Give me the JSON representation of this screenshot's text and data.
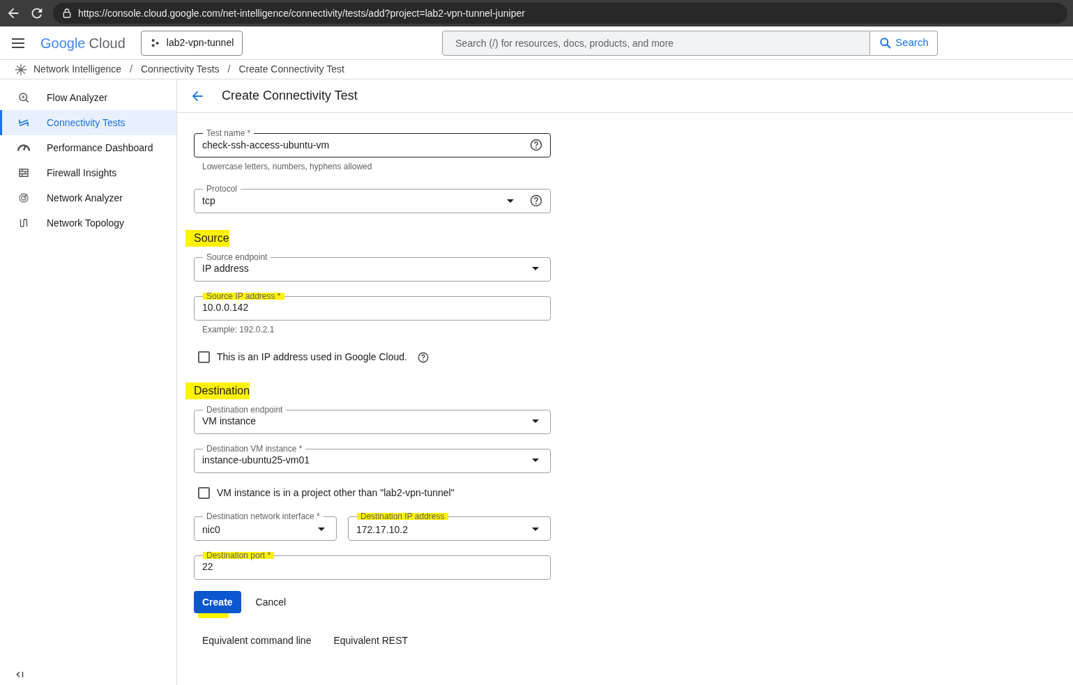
{
  "browser": {
    "url": "https://console.cloud.google.com/net-intelligence/connectivity/tests/add?project=lab2-vpn-tunnel-juniper"
  },
  "header": {
    "logo_google": "Google",
    "logo_cloud": "Cloud",
    "project": "lab2-vpn-tunnel",
    "search_placeholder": "Search (/) for resources, docs, products, and more",
    "search_button": "Search"
  },
  "breadcrumbs": [
    "Network Intelligence",
    "Connectivity Tests",
    "Create Connectivity Test"
  ],
  "breadcrumb_separator": "/",
  "sidebar": {
    "items": [
      {
        "label": "Flow Analyzer",
        "selected": false
      },
      {
        "label": "Connectivity Tests",
        "selected": true
      },
      {
        "label": "Performance Dashboard",
        "selected": false
      },
      {
        "label": "Firewall Insights",
        "selected": false
      },
      {
        "label": "Network Analyzer",
        "selected": false
      },
      {
        "label": "Network Topology",
        "selected": false
      }
    ]
  },
  "page": {
    "title": "Create Connectivity Test"
  },
  "form": [
    {
      "kind": "input",
      "label": "Test name *",
      "value": "check-ssh-access-ubuntu-vm",
      "help": true,
      "focused": true,
      "highlighted": false
    },
    {
      "kind": "hint",
      "text": "Lowercase letters, numbers, hyphens allowed"
    },
    {
      "kind": "select",
      "label": "Protocol",
      "value": "tcp",
      "help": true,
      "highlighted": false
    },
    {
      "kind": "section",
      "text": "Source",
      "highlighted": true
    },
    {
      "kind": "select",
      "label": "Source endpoint",
      "value": "IP address",
      "help": false,
      "highlighted": false
    },
    {
      "kind": "input",
      "label": "Source IP address *",
      "value": "10.0.0.142",
      "help": false,
      "focused": false,
      "highlighted": true
    },
    {
      "kind": "hint",
      "text": "Example: 192.0.2.1"
    },
    {
      "kind": "checkbox",
      "label": "This is an IP address used in Google Cloud.",
      "checked": false,
      "help": true
    },
    {
      "kind": "section",
      "text": "Destination",
      "highlighted": true
    },
    {
      "kind": "select",
      "label": "Destination endpoint",
      "value": "VM instance",
      "help": false,
      "highlighted": false
    },
    {
      "kind": "select",
      "label": "Destination VM instance *",
      "value": "instance-ubuntu25-vm01",
      "help": false,
      "highlighted": false
    },
    {
      "kind": "checkbox",
      "label": "VM instance is in a project other than \"lab2-vpn-tunnel\"",
      "checked": false,
      "help": false
    },
    {
      "kind": "pair",
      "fields": [
        {
          "label": "Destination network interface *",
          "value": "nic0",
          "highlighted": false
        },
        {
          "label": "Destination IP address",
          "value": "172.17.10.2",
          "highlighted": true
        }
      ]
    },
    {
      "kind": "input",
      "label": "Destination port *",
      "value": "22",
      "help": false,
      "focused": false,
      "highlighted": true
    }
  ],
  "actions": {
    "create": "Create",
    "create_highlighted": true,
    "cancel": "Cancel"
  },
  "links": [
    "Equivalent command line",
    "Equivalent REST"
  ]
}
